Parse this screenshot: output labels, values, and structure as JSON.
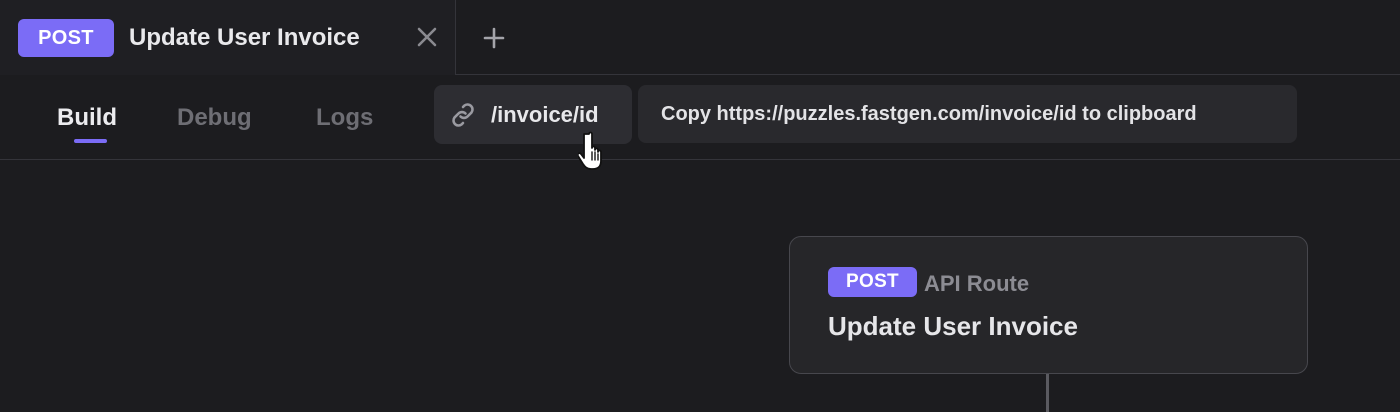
{
  "tab": {
    "method": "POST",
    "title": "Update User Invoice"
  },
  "subnav": {
    "items": [
      {
        "label": "Build",
        "active": true
      },
      {
        "label": "Debug",
        "active": false
      },
      {
        "label": "Logs",
        "active": false
      }
    ],
    "route": "/invoice/id",
    "copy_tooltip": "Copy https://puzzles.fastgen.com/invoice/id to clipboard"
  },
  "node": {
    "method": "POST",
    "type": "API Route",
    "title": "Update User Invoice"
  },
  "colors": {
    "accent": "#7b6cf6",
    "background": "#1c1c1f",
    "panel": "#262629"
  },
  "icons": {
    "close": "close-icon",
    "add": "plus-icon",
    "link": "link-icon",
    "cursor": "hand-pointer-icon"
  }
}
